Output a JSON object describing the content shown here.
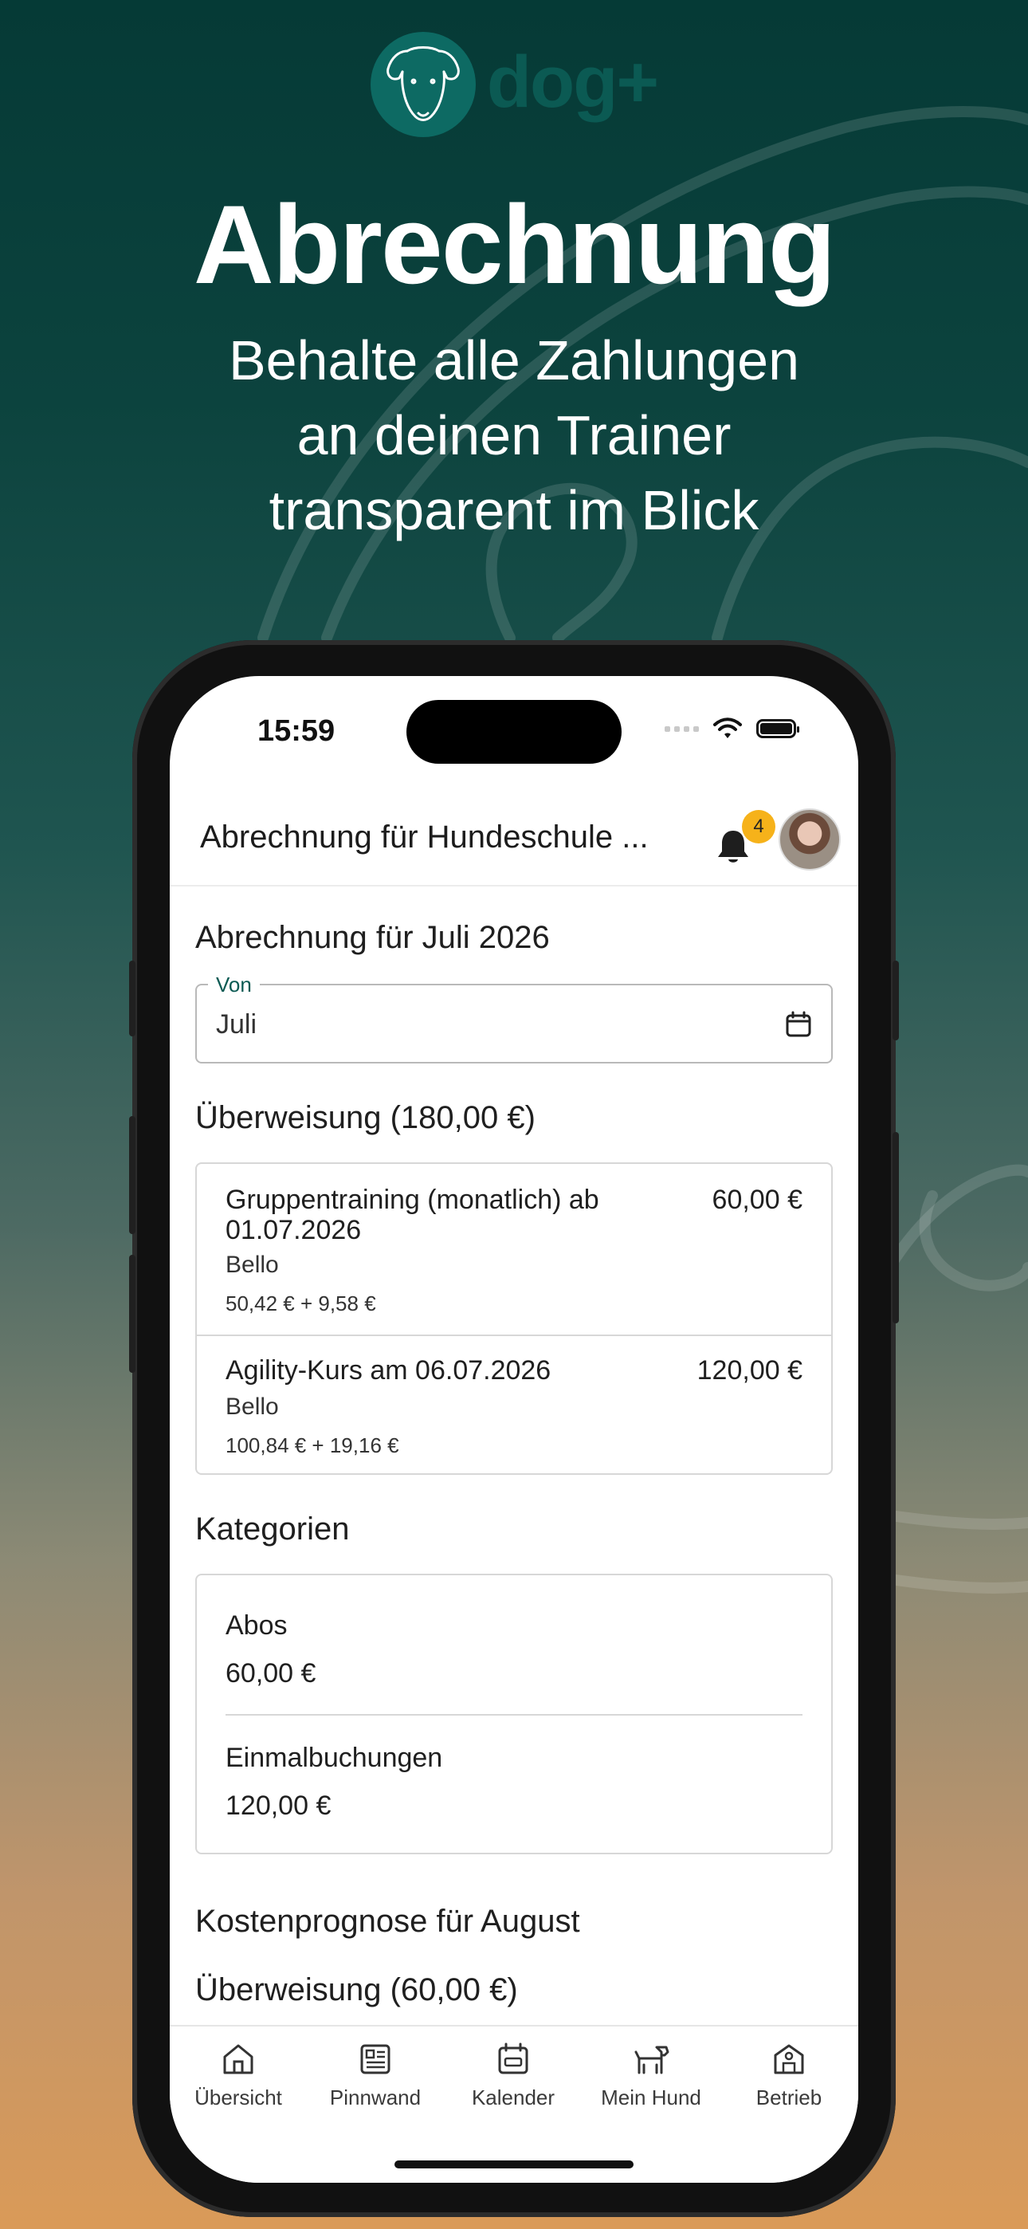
{
  "brand": {
    "logo_text": "dog+"
  },
  "hero": {
    "title": "Abrechnung",
    "subtitle_lines": [
      "Behalte alle Zahlungen",
      "an deinen Trainer",
      "transparent im Blick"
    ]
  },
  "status_bar": {
    "time": "15:59"
  },
  "app_bar": {
    "title": "Abrechnung für Hundeschule ...",
    "notification_count": "4"
  },
  "billing": {
    "heading": "Abrechnung für Juli 2026",
    "period_field": {
      "label": "Von",
      "value": "Juli"
    },
    "transfer_heading": "Überweisung (180,00 €)",
    "transfer_items": [
      {
        "title": "Gruppentraining (monatlich) ab 01.07.2026",
        "amount": "60,00 €",
        "dog": "Bello",
        "breakdown": "50,42 € + 9,58 €"
      },
      {
        "title": "Agility-Kurs am 06.07.2026",
        "amount": "120,00 €",
        "dog": "Bello",
        "breakdown": "100,84 € + 19,16 €"
      }
    ],
    "categories_heading": "Kategorien",
    "categories": [
      {
        "name": "Abos",
        "amount": "60,00 €"
      },
      {
        "name": "Einmalbuchungen",
        "amount": "120,00 €"
      }
    ],
    "forecast_heading": "Kostenprognose für August",
    "forecast_transfer_heading": "Überweisung (60,00 €)"
  },
  "bottom_nav": [
    {
      "label": "Übersicht",
      "icon": "home-icon"
    },
    {
      "label": "Pinnwand",
      "icon": "board-icon"
    },
    {
      "label": "Kalender",
      "icon": "calendar-icon"
    },
    {
      "label": "Mein Hund",
      "icon": "dog-icon"
    },
    {
      "label": "Betrieb",
      "icon": "business-icon"
    }
  ],
  "colors": {
    "accent": "#0b5a53",
    "badge": "#f6b21a"
  }
}
